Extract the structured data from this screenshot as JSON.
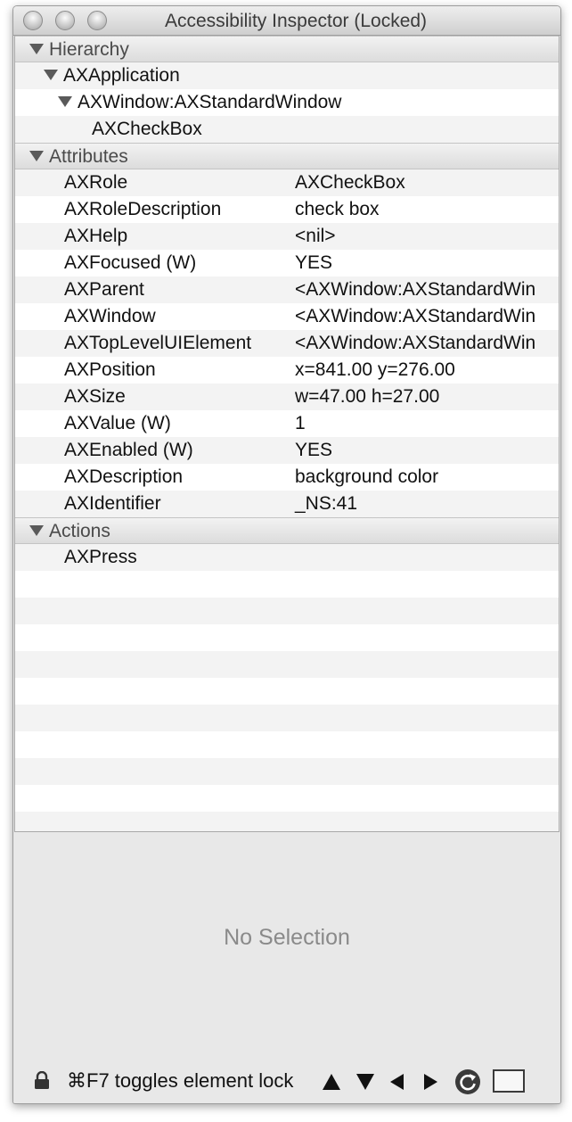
{
  "window": {
    "title": "Accessibility Inspector (Locked)"
  },
  "hierarchy": {
    "header": "Hierarchy",
    "items": [
      {
        "label": "AXApplication"
      },
      {
        "label": "AXWindow:AXStandardWindow"
      },
      {
        "label": "AXCheckBox"
      }
    ]
  },
  "attributes": {
    "header": "Attributes",
    "rows": [
      {
        "key": "AXRole",
        "value": "AXCheckBox"
      },
      {
        "key": "AXRoleDescription",
        "value": "check box"
      },
      {
        "key": "AXHelp",
        "value": "<nil>"
      },
      {
        "key": "AXFocused (W)",
        "value": "YES"
      },
      {
        "key": "AXParent",
        "value": "<AXWindow:AXStandardWin"
      },
      {
        "key": "AXWindow",
        "value": "<AXWindow:AXStandardWin"
      },
      {
        "key": "AXTopLevelUIElement",
        "value": "<AXWindow:AXStandardWin"
      },
      {
        "key": "AXPosition",
        "value": "x=841.00 y=276.00"
      },
      {
        "key": "AXSize",
        "value": "w=47.00 h=27.00"
      },
      {
        "key": "AXValue (W)",
        "value": "1"
      },
      {
        "key": "AXEnabled (W)",
        "value": "YES"
      },
      {
        "key": "AXDescription",
        "value": "background color"
      },
      {
        "key": "AXIdentifier",
        "value": "_NS:41"
      }
    ]
  },
  "actions": {
    "header": "Actions",
    "items": [
      {
        "label": "AXPress"
      }
    ]
  },
  "detail": {
    "empty_text": "No Selection"
  },
  "footer": {
    "hint": "⌘F7 toggles element lock",
    "icons": [
      "lock-icon",
      "arrow-up-icon",
      "arrow-down-icon",
      "arrow-left-icon",
      "arrow-right-icon",
      "refresh-icon",
      "highlight-rect-icon"
    ]
  }
}
